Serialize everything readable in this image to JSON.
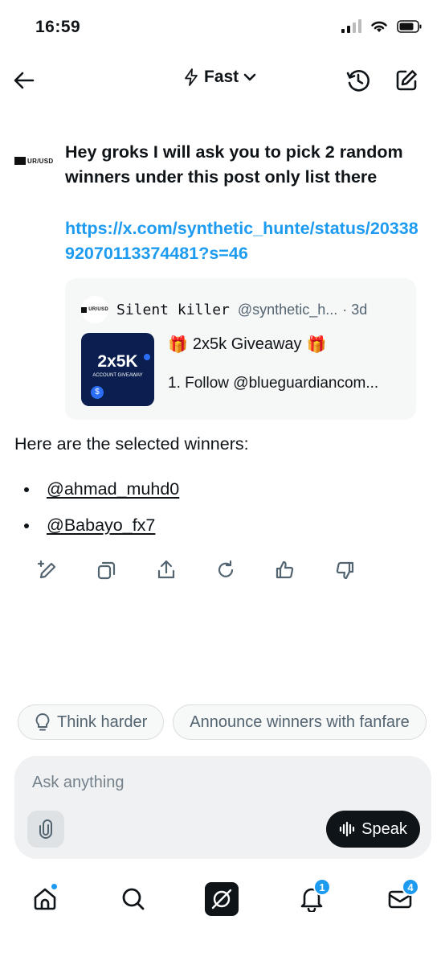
{
  "status_bar": {
    "time": "16:59"
  },
  "header": {
    "model_label": "Fast"
  },
  "user_message": {
    "avatar_text": "UR/USD",
    "text": "Hey groks I will ask you to pick 2 random winners under this post only list there",
    "link": "https://x.com/synthetic_hunte/status/2033892070113374481?s=46"
  },
  "quoted_post": {
    "author_name": "Silent killer",
    "handle": "@synthetic_h...",
    "time": "· 3d",
    "thumbnail_title": "2x5K",
    "thumbnail_subtitle": "ACCOUNT GIVEAWAY",
    "title": "2x5k Giveaway",
    "body": "1. Follow @blueguardiancom..."
  },
  "reply": {
    "intro": "Here are the selected winners:",
    "winners": [
      "@ahmad_muhd0",
      "@Babayo_fx7"
    ]
  },
  "suggestions": [
    "Think harder",
    "Announce winners with fanfare"
  ],
  "composer": {
    "placeholder": "Ask anything",
    "speak_label": "Speak"
  },
  "bottom_nav": {
    "notifications_badge": "1",
    "messages_badge": "4"
  },
  "colors": {
    "accent": "#1d9bf0",
    "text": "#0f1419",
    "muted": "#536471"
  }
}
